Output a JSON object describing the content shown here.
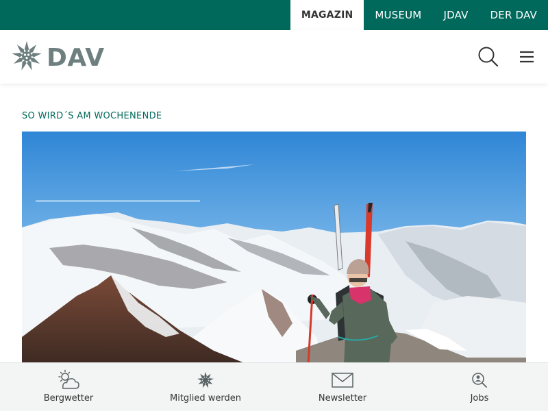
{
  "topnav": {
    "items": [
      {
        "label": "MAGAZIN",
        "active": true
      },
      {
        "label": "MUSEUM",
        "active": false
      },
      {
        "label": "JDAV",
        "active": false
      },
      {
        "label": "DER DAV",
        "active": false
      }
    ]
  },
  "header": {
    "logo_text": "DAV",
    "icons": {
      "logo": "edelweiss-icon",
      "search": "search-icon",
      "menu": "hamburger-menu-icon"
    }
  },
  "main": {
    "section_label": "SO WIRD´S AM WOCHENENDE",
    "hero_image": "photo: ski mountaineer on snowy summit ridge"
  },
  "bottombar": {
    "items": [
      {
        "label": "Bergwetter",
        "icon": "weather-icon"
      },
      {
        "label": "Mitglied werden",
        "icon": "edelweiss-icon"
      },
      {
        "label": "Newsletter",
        "icon": "envelope-icon"
      },
      {
        "label": "Jobs",
        "icon": "job-search-icon"
      }
    ]
  },
  "colors": {
    "brand_green": "#00695b",
    "logo_gray": "#6e7f80",
    "bar_bg": "#f3f4f4"
  }
}
